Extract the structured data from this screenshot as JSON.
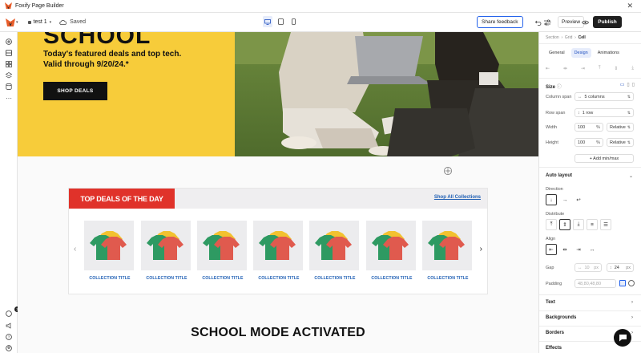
{
  "app": {
    "title": "Foxify Page Builder"
  },
  "toolbar": {
    "page_name": "test 1",
    "saved_label": "Saved",
    "share_label": "Share feedback",
    "preview_label": "Preview",
    "publish_label": "Publish"
  },
  "hero": {
    "top_text": "SCHOOL",
    "subtitle_line1": "Today's featured deals and top tech.",
    "subtitle_line2": "Valid through 9/20/24.*",
    "button_label": "SHOP DEALS"
  },
  "deals": {
    "title": "TOP DEALS OF THE DAY",
    "shop_all_label": "Shop All Collections",
    "collections": [
      {
        "label": "COLLECTION TITLE"
      },
      {
        "label": "COLLECTION TITLE"
      },
      {
        "label": "COLLECTION TITLE"
      },
      {
        "label": "COLLECTION TITLE"
      },
      {
        "label": "COLLECTION TITLE"
      },
      {
        "label": "COLLECTION TITLE"
      },
      {
        "label": "COLLECTION TITLE"
      }
    ]
  },
  "section2": {
    "title": "SCHOOL MODE ACTIVATED"
  },
  "rail": {
    "notification_count": "3"
  },
  "panel": {
    "breadcrumb": {
      "a": "Section",
      "b": "Grid",
      "c": "Cell"
    },
    "tabs": {
      "general": "General",
      "design": "Design",
      "animations": "Animations"
    },
    "size": {
      "title": "Size",
      "column_span_label": "Column span",
      "column_span_value": "5 columns",
      "row_span_label": "Row span",
      "row_span_value": "1 row",
      "width_label": "Width",
      "width_value": "100",
      "width_unit": "%",
      "width_mode": "Relative",
      "height_label": "Height",
      "height_value": "100",
      "height_unit": "%",
      "height_mode": "Relative",
      "add_minmax": "+ Add min/max"
    },
    "auto_layout": {
      "title": "Auto layout",
      "direction_label": "Direction",
      "distribute_label": "Distribute",
      "align_label": "Align",
      "gap_label": "Gap",
      "gap_x": "10",
      "gap_x_unit": "px",
      "gap_y": "24",
      "gap_y_unit": "px",
      "padding_label": "Padding",
      "padding_value": "48,80,48,80"
    },
    "sections": {
      "text": "Text",
      "backgrounds": "Backgrounds",
      "borders": "Borders",
      "effects": "Effects"
    }
  },
  "colors": {
    "accent": "#2563eb",
    "hero_yellow": "#f7cc3a",
    "deal_red": "#e0322a",
    "link_blue": "#1f5fb4"
  }
}
